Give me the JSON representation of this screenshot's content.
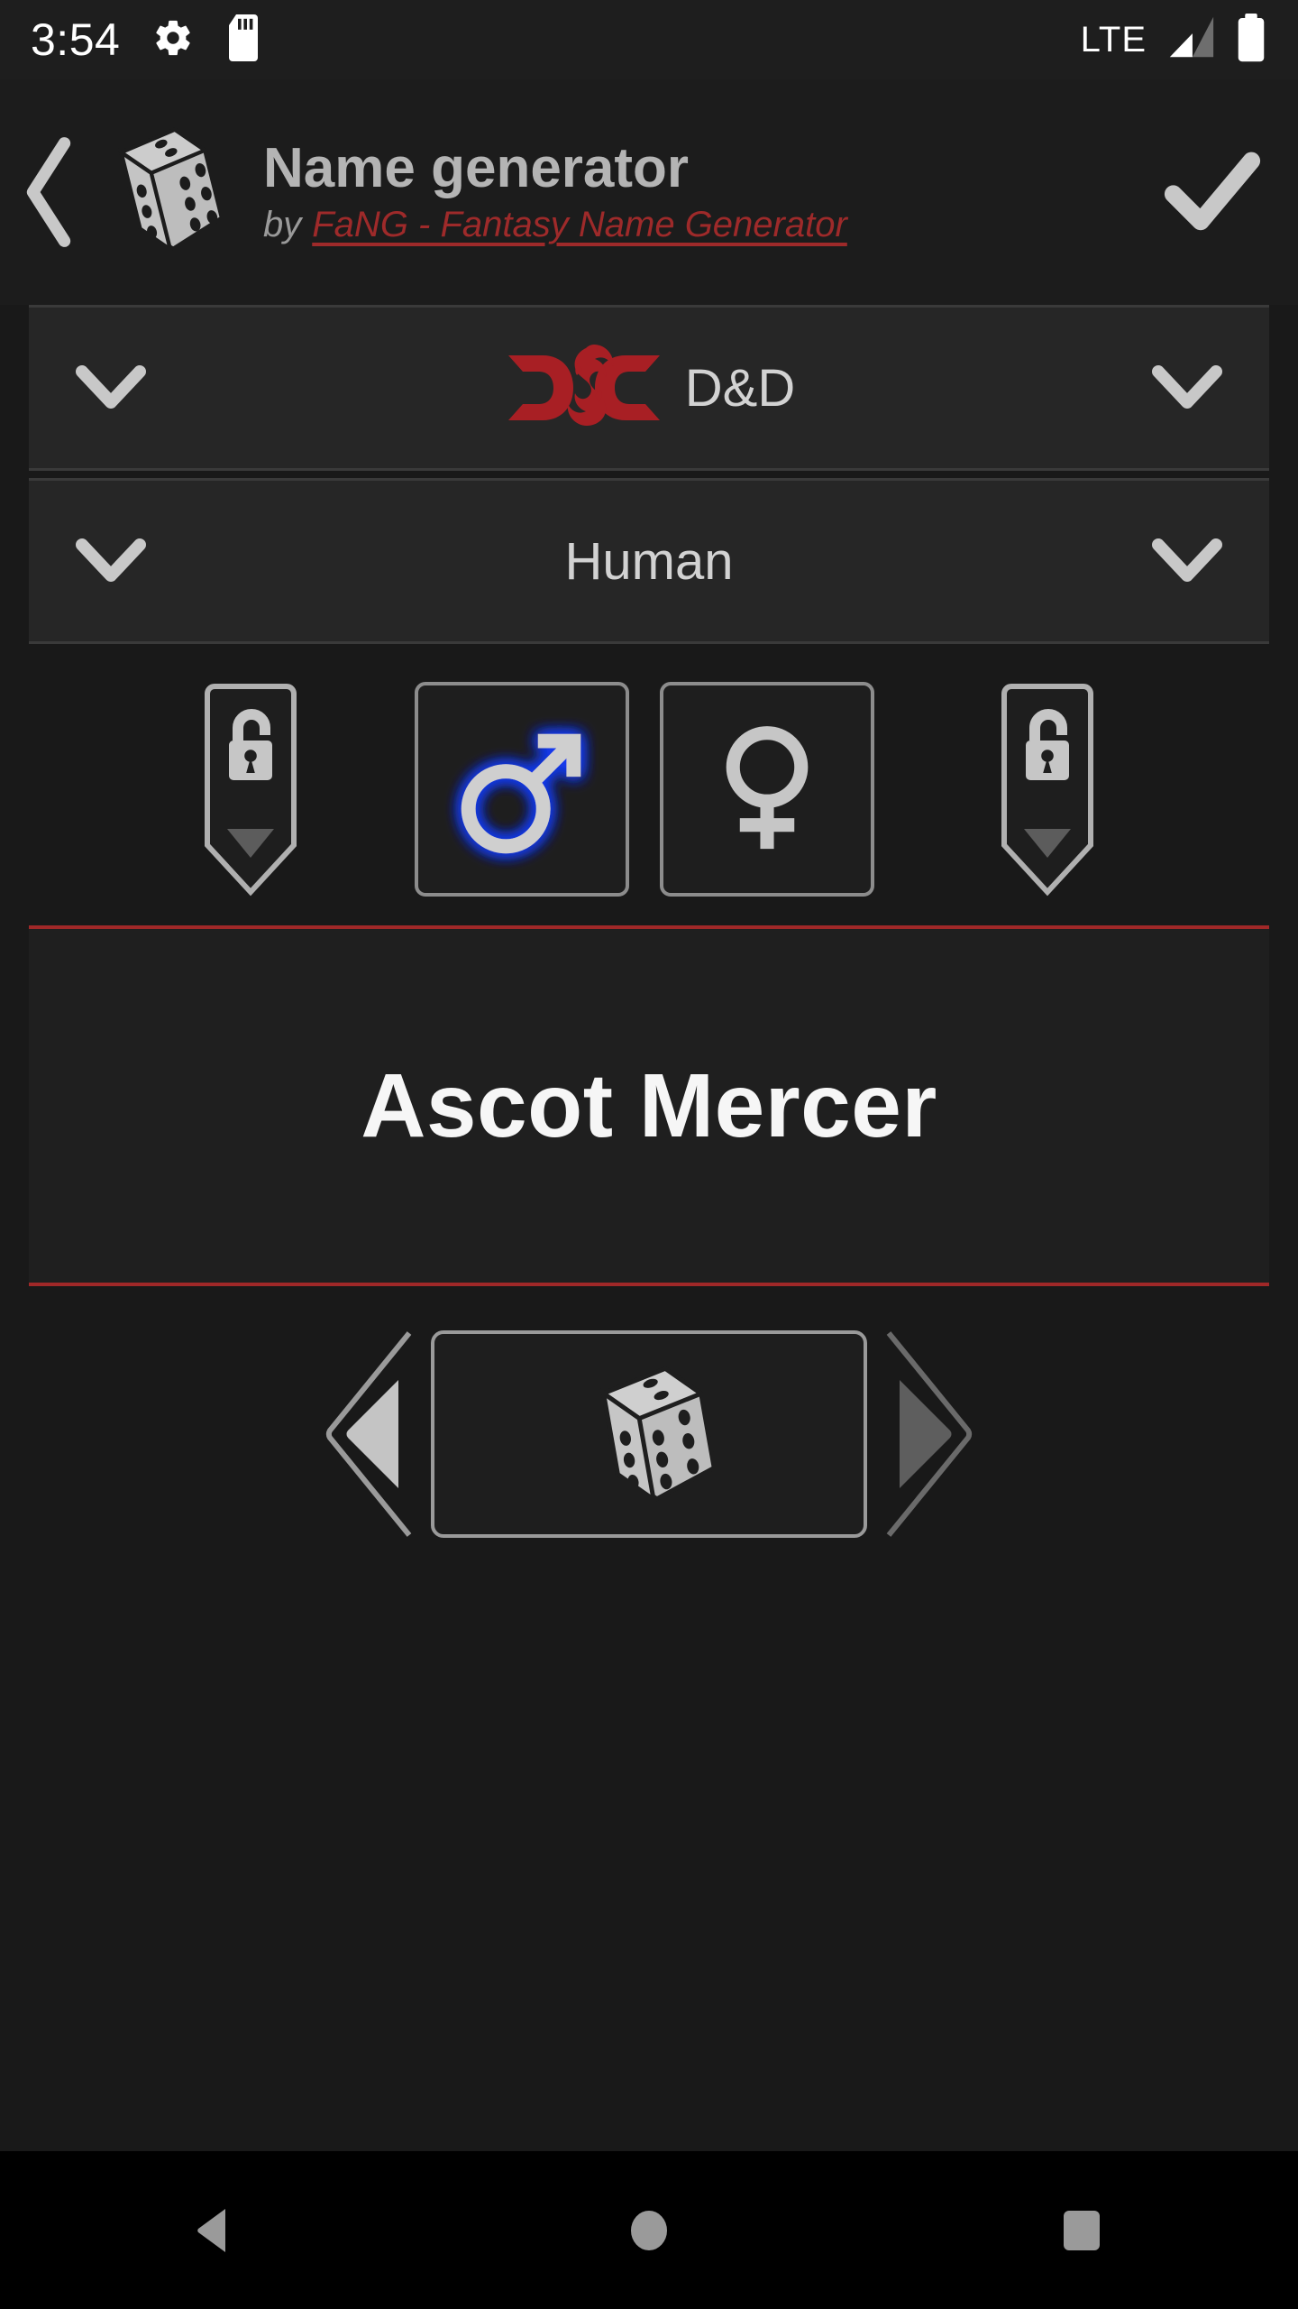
{
  "status_bar": {
    "time": "3:54",
    "settings_icon": "gear-icon",
    "storage_icon": "sd-card-icon",
    "network_label": "LTE",
    "signal_icon": "signal-bars-icon",
    "battery_icon": "battery-full-icon"
  },
  "header": {
    "back_icon": "back-chevron-icon",
    "app_icon": "dice-icon",
    "title": "Name generator",
    "by_prefix": "by",
    "author_link": "FaNG - Fantasy Name Generator",
    "confirm_icon": "checkmark-icon",
    "link_color": "#9e2a2a",
    "title_color": "#b4b4b4"
  },
  "selectors": [
    {
      "name": "universe-selector",
      "label": "D&D",
      "logo_icon": "dnd-logo-icon",
      "left_icon": "chevron-down-icon",
      "right_icon": "chevron-down-icon"
    },
    {
      "name": "race-selector",
      "label": "Human",
      "logo_icon": "",
      "left_icon": "chevron-down-icon",
      "right_icon": "chevron-down-icon"
    }
  ],
  "gender_row": {
    "lock_left_icon": "unlocked-padlock-tag-icon",
    "lock_right_icon": "unlocked-padlock-tag-icon",
    "male_icon": "male-gender-icon",
    "female_icon": "female-gender-icon",
    "male_selected": true,
    "female_selected": false,
    "selected_glow_color": "#1a3cf0"
  },
  "result": {
    "name": "Ascot Mercer",
    "border_color": "#a02828"
  },
  "controls": {
    "previous_icon": "previous-arrow-icon",
    "previous_enabled": true,
    "generate_icon": "dice-icon",
    "next_icon": "next-arrow-icon",
    "next_enabled": false
  },
  "android_nav": {
    "back_icon": "nav-back-icon",
    "home_icon": "nav-home-icon",
    "recents_icon": "nav-recents-icon"
  }
}
